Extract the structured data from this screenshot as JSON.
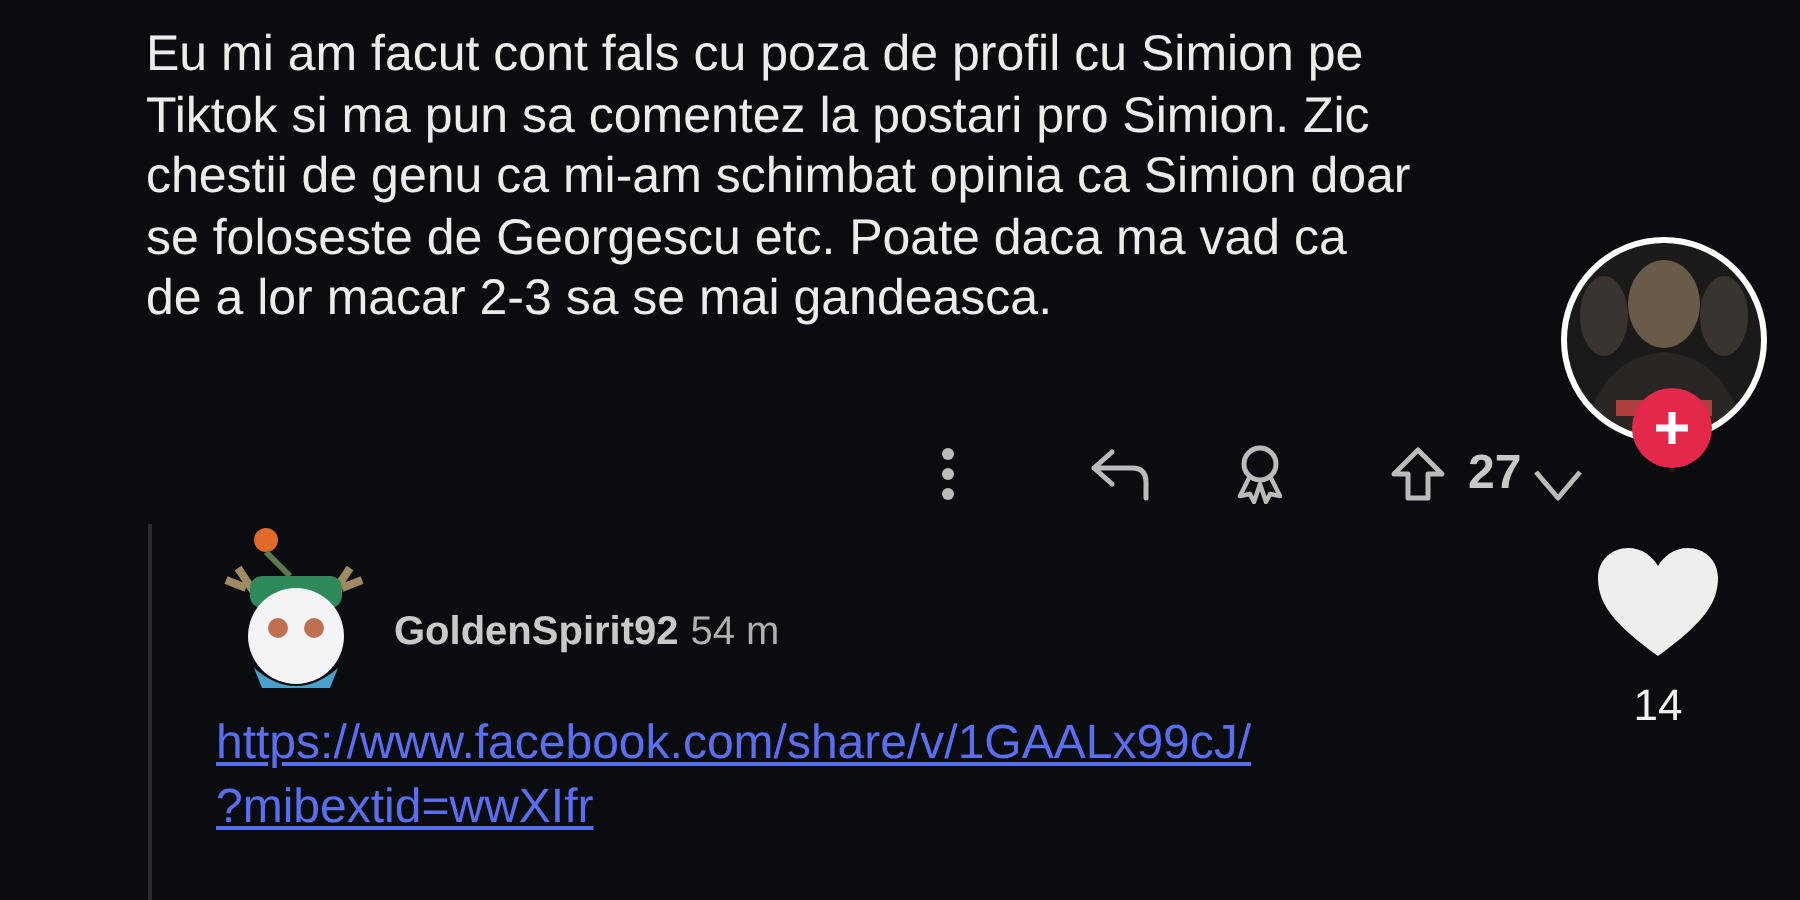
{
  "comment": {
    "lines": [
      "Eu mi am facut cont fals cu poza de profil cu Simion pe",
      "Tiktok si ma pun sa comentez la postari pro Simion. Zic",
      "chestii de genu ca mi-am schimbat opinia ca Simion doar",
      "se foloseste de Georgescu etc. Poate daca ma vad ca",
      "de a lor macar 2-3 sa se mai gandeasca."
    ],
    "votes": "27"
  },
  "reply": {
    "username": "GoldenSpirit92",
    "time": "54 m",
    "link_lines": [
      "https://www.facebook.com/share/v/1GAALx99cJ/",
      "?mibextid=wwXIfr"
    ]
  },
  "side": {
    "likes": "14"
  }
}
